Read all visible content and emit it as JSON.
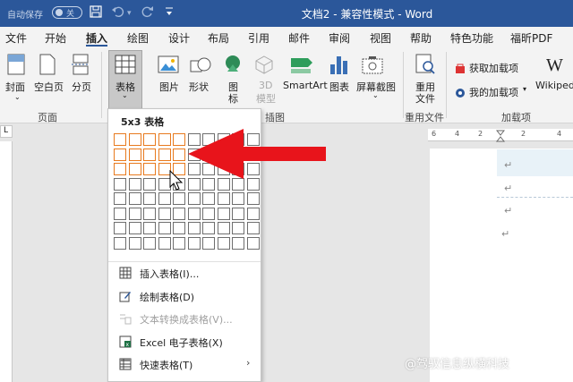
{
  "titlebar": {
    "autosave_label": "自动保存",
    "toggle_state": "关",
    "doc_title": "文档2  -  兼容性模式  -  Word"
  },
  "tabs": [
    "文件",
    "开始",
    "插入",
    "绘图",
    "设计",
    "布局",
    "引用",
    "邮件",
    "审阅",
    "视图",
    "帮助",
    "特色功能",
    "福昕PDF"
  ],
  "active_tab": "插入",
  "ribbon": {
    "cover": "封面",
    "blank_page": "空白页",
    "page_break": "分页",
    "table": "表格",
    "picture": "图片",
    "shapes": "形状",
    "icons": "图",
    "icons2": "标",
    "model3d": "3D",
    "model3d2": "模型",
    "smartart": "SmartArt",
    "chart": "图表",
    "screenshot": "屏幕截图",
    "reuse": "重用",
    "reuse2": "文件",
    "get_addins": "获取加载项",
    "my_addins": "我的加载项",
    "wikipedia": "Wikipedi",
    "groups": {
      "pages": "页面",
      "illustrations": "插图",
      "reuse_files": "重用文件",
      "addins": "加载项"
    }
  },
  "ruler_numbers": [
    "6",
    "4",
    "2",
    "2",
    "4"
  ],
  "dropdown": {
    "title": "5x3 表格",
    "grid": {
      "cols": 10,
      "rows": 8,
      "selected_cols": 5,
      "selected_rows": 3
    },
    "items": [
      {
        "label": "插入表格(I)...",
        "disabled": false
      },
      {
        "label": "绘制表格(D)",
        "disabled": false
      },
      {
        "label": "文本转换成表格(V)...",
        "disabled": true
      },
      {
        "label": "Excel 电子表格(X)",
        "disabled": false
      },
      {
        "label": "快速表格(T)",
        "disabled": false
      }
    ],
    "submenu_arrow": "›"
  },
  "para_mark": "↵",
  "watermark": "@驾驭信息纵横科技",
  "colors": {
    "titlebar": "#2b579a",
    "selection": "#e87a1e",
    "arrow": "#e8141b"
  }
}
